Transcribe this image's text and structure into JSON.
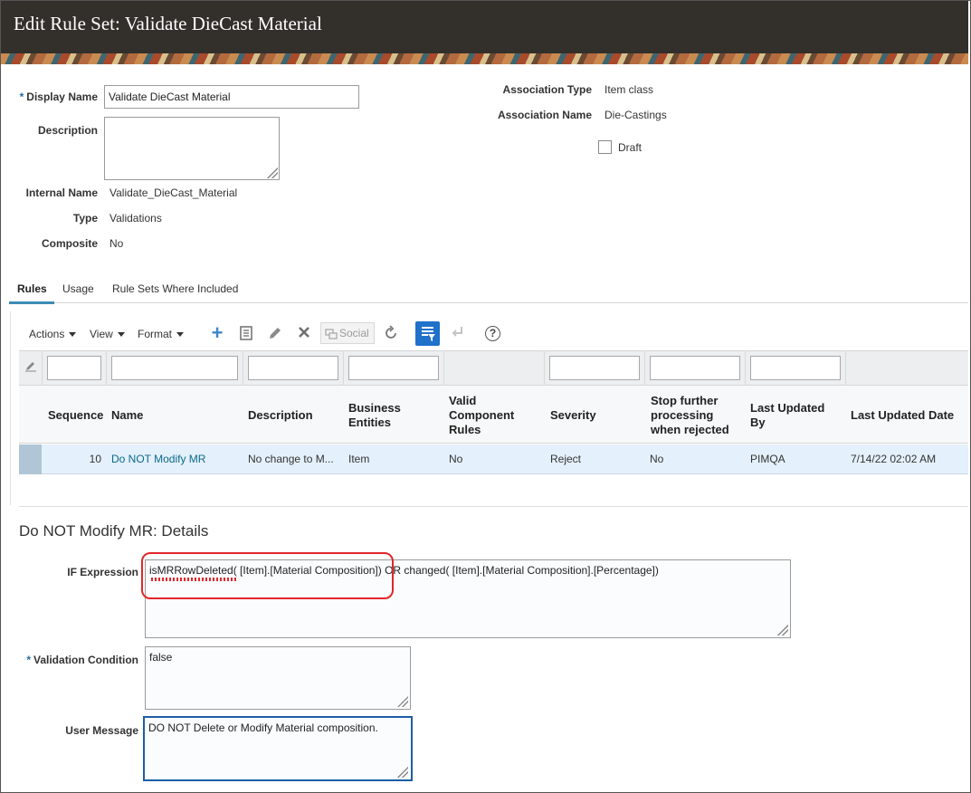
{
  "window": {
    "title": "Edit Rule Set: Validate DieCast Material"
  },
  "form": {
    "display_name_label": "Display Name",
    "display_name_value": "Validate DieCast Material",
    "description_label": "Description",
    "description_value": "",
    "internal_name_label": "Internal Name",
    "internal_name_value": "Validate_DieCast_Material",
    "type_label": "Type",
    "type_value": "Validations",
    "composite_label": "Composite",
    "composite_value": "No",
    "association_type_label": "Association Type",
    "association_type_value": "Item class",
    "association_name_label": "Association Name",
    "association_name_value": "Die-Castings",
    "draft_label": "Draft",
    "required_marker": "*"
  },
  "tabs": [
    {
      "label": "Rules",
      "active": true
    },
    {
      "label": "Usage",
      "active": false
    },
    {
      "label": "Rule Sets Where Included",
      "active": false
    }
  ],
  "toolbar": {
    "actions_label": "Actions",
    "view_label": "View",
    "format_label": "Format",
    "social_label": "Social",
    "help_glyph": "?"
  },
  "table": {
    "columns": [
      "Sequence",
      "Name",
      "Description",
      "Business Entities",
      "Valid Component Rules",
      "Severity",
      "Stop further processing when rejected",
      "Last Updated By",
      "Last Updated Date"
    ],
    "header_lines": {
      "business": [
        "Business",
        "Entities"
      ],
      "valid": [
        "Valid",
        "Component",
        "Rules"
      ],
      "stop": [
        "Stop further",
        "processing",
        "when rejected"
      ],
      "lastby": [
        "Last Updated",
        "By"
      ]
    },
    "rows": [
      {
        "sequence": "10",
        "name": "Do NOT Modify MR",
        "description": "No change to M...",
        "business_entities": "Item",
        "valid_component_rules": "No",
        "severity": "Reject",
        "stop_processing": "No",
        "last_updated_by": "PIMQA",
        "last_updated_date": "7/14/22 02:02 AM"
      }
    ]
  },
  "details": {
    "title": "Do NOT Modify MR: Details",
    "if_expression_label": "IF Expression",
    "if_expression_value": "isMRRowDeleted( [Item].[Material Composition]) OR changed( [Item].[Material Composition].[Percentage])",
    "validation_condition_label": "Validation Condition",
    "validation_condition_value": "false",
    "user_message_label": "User Message",
    "user_message_value": "DO NOT Delete or Modify Material composition."
  },
  "colors": {
    "titlebar_bg": "#33302c",
    "accent_blue": "#1f71c9",
    "selected_row": "#e4f0fb",
    "link": "#0b6a8a",
    "highlight_red": "#e3262b"
  }
}
